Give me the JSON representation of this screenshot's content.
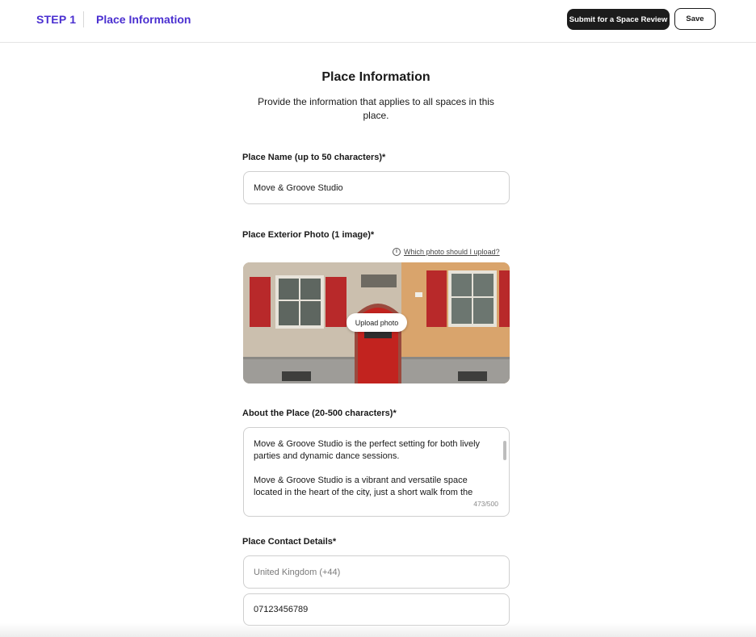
{
  "header": {
    "step_label": "STEP 1",
    "step_title": "Place Information",
    "submit_label": "Submit for a Space Review",
    "save_label": "Save"
  },
  "page": {
    "title": "Place Information",
    "subtitle": "Provide the information that applies to all spaces in this place."
  },
  "place_name": {
    "label": "Place Name (up to 50 characters)*",
    "value": "Move & Groove Studio"
  },
  "exterior_photo": {
    "label": "Place Exterior Photo (1 image)*",
    "help_link": "Which photo should I upload?",
    "help_icon": "info-icon",
    "upload_label": "Upload photo"
  },
  "about": {
    "label": "About the Place (20-500 characters)*",
    "value": "Move & Groove Studio is the perfect setting for both lively parties and dynamic dance sessions.\n\nMove & Groove Studio is a vibrant and versatile space located in the heart of the city, just a short walk from the",
    "counter": "473/500"
  },
  "contact": {
    "label": "Place Contact Details*",
    "country_placeholder": "United Kingdom (+44)",
    "phone_value": "07123456789"
  },
  "colors": {
    "accent": "#4a2fd0",
    "primary_button": "#1c1c1c"
  }
}
